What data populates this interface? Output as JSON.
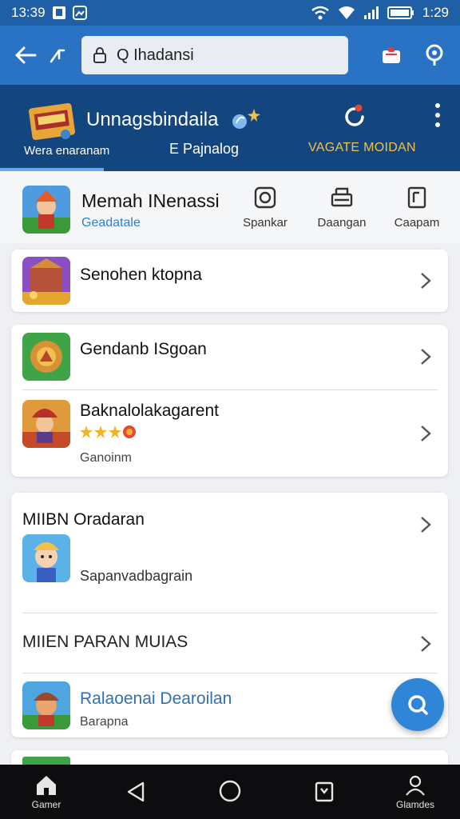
{
  "status": {
    "time_left": "13:39",
    "time_right": "1:29"
  },
  "search": {
    "value": "Q Ihadansi"
  },
  "banner": {
    "title": "Unnagsbindaila",
    "tabs": [
      "Wera enaranam",
      "E Pajnalog",
      "VAGATE MOIDAN"
    ]
  },
  "profile": {
    "name": "Memah INenassi",
    "subtitle": "Geadatale",
    "actions": [
      {
        "label": "Spankar",
        "icon": "camera-icon"
      },
      {
        "label": "Daangan",
        "icon": "printer-icon"
      },
      {
        "label": "Caapam",
        "icon": "document-icon"
      }
    ]
  },
  "list": {
    "row1": {
      "title": "Senohen ktopna"
    },
    "row2": {
      "title": "Gendanb ISgoan"
    },
    "row3": {
      "title": "Baknalolakagarent",
      "sub": "Ganoinm"
    },
    "section1": {
      "title": "MIIBN Oradaran",
      "sub": "Sapanvadbagrain"
    },
    "section2": {
      "title": "MIIEN PARAN MUIAS"
    },
    "row4": {
      "title": "Ralaoenai Dearoilan",
      "sub": "Barapna"
    }
  },
  "nav": {
    "left_label": "Gamer",
    "right_label": "Glamdes"
  },
  "colors": {
    "primary": "#2a72c4",
    "banner": "#13457f",
    "accent": "#f0c24b",
    "link": "#2f7fd3"
  }
}
